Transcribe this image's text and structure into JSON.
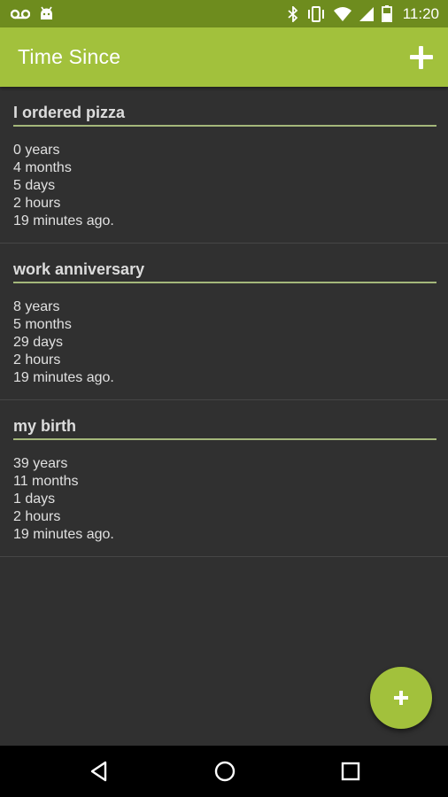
{
  "status_bar": {
    "time": "11:20",
    "icons": [
      "voicemail-icon",
      "android-icon",
      "bluetooth-icon",
      "vibrate-icon",
      "wifi-icon",
      "signal-icon",
      "battery-icon"
    ]
  },
  "app_bar": {
    "title": "Time Since",
    "action_icon": "plus-icon"
  },
  "entries": [
    {
      "title": "I ordered pizza",
      "lines": [
        "0 years",
        "4 months",
        "5 days",
        "2 hours",
        "19 minutes ago."
      ]
    },
    {
      "title": "work anniversary",
      "lines": [
        "8 years",
        "5 months",
        "29 days",
        "2 hours",
        "19 minutes ago."
      ]
    },
    {
      "title": "my birth",
      "lines": [
        "39 years",
        "11 months",
        "1 days",
        "2 hours",
        "19 minutes ago."
      ]
    }
  ],
  "fab": {
    "icon": "plus-icon"
  },
  "nav_bar": {
    "icons": [
      "back-icon",
      "home-icon",
      "recents-icon"
    ]
  },
  "colors": {
    "status_bar": "#6e8c1e",
    "accent": "#a2c13c",
    "background": "#303030",
    "divider_accent": "#a4b77a"
  }
}
